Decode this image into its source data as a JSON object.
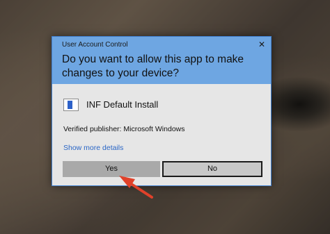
{
  "dialog": {
    "window_title": "User Account Control",
    "question": "Do you want to allow this app to make changes to your device?",
    "app_name": "INF Default Install",
    "publisher": "Verified publisher: Microsoft Windows",
    "details_link": "Show more details",
    "yes_label": "Yes",
    "no_label": "No",
    "close_glyph": "✕"
  },
  "icons": {
    "app": "installer-window-icon",
    "close": "close-icon",
    "annotation": "red-arrow-pointer"
  },
  "colors": {
    "header": "#6ea6e2",
    "body": "#e6e6e6",
    "link": "#2a66c6",
    "arrow": "#e0412a"
  }
}
